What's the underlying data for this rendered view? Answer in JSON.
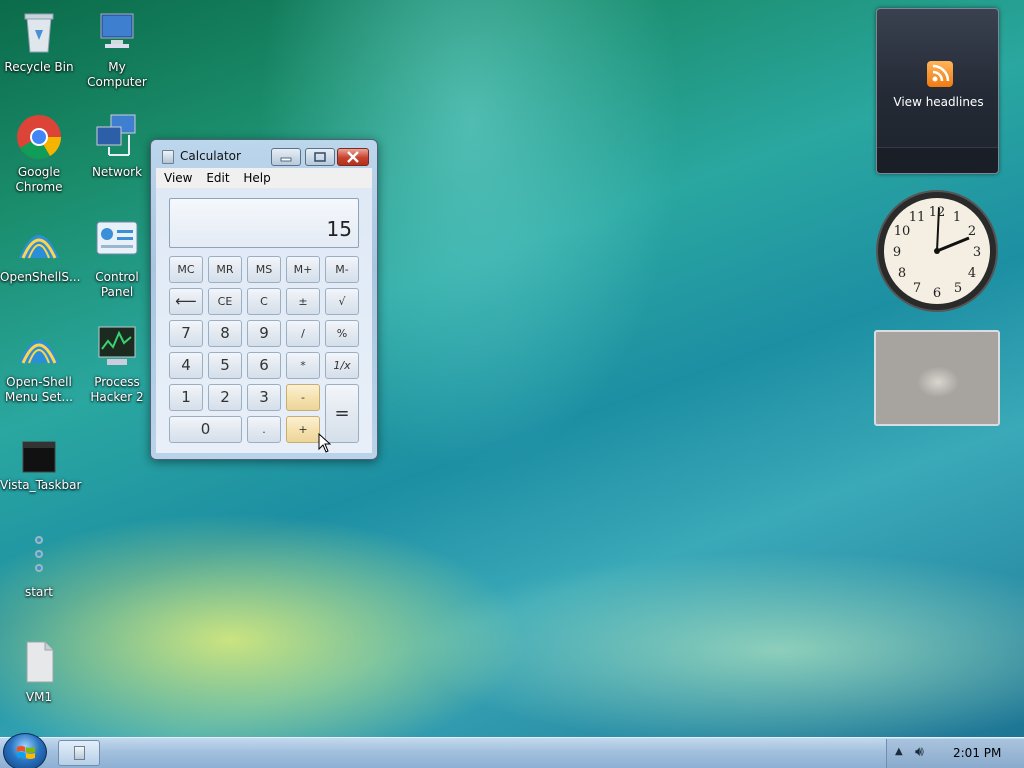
{
  "desktop": {
    "icons": [
      {
        "label": "Recycle Bin",
        "icon": "recycle-bin-icon"
      },
      {
        "label": "My Computer",
        "icon": "computer-icon"
      },
      {
        "label": "Google Chrome",
        "icon": "chrome-icon"
      },
      {
        "label": "Network",
        "icon": "network-icon"
      },
      {
        "label": "OpenShellS...",
        "icon": "openshell-icon"
      },
      {
        "label": "Control Panel",
        "icon": "control-panel-icon"
      },
      {
        "label": "Open-Shell Menu Set...",
        "icon": "openshell-icon"
      },
      {
        "label": "Process Hacker 2",
        "icon": "process-hacker-icon"
      },
      {
        "label": "Vista_Taskbar",
        "icon": "black-file-icon"
      },
      {
        "label": "start",
        "icon": "start-bat-icon"
      },
      {
        "label": "VM1",
        "icon": "file-icon"
      }
    ]
  },
  "calculator": {
    "title": "Calculator",
    "menu": [
      "View",
      "Edit",
      "Help"
    ],
    "display": "15",
    "keys": {
      "mc": "MC",
      "mr": "MR",
      "ms": "MS",
      "mplus": "M+",
      "mminus": "M-",
      "back": "⟵",
      "ce": "CE",
      "c": "C",
      "plusminus": "±",
      "sqrt": "√",
      "k7": "7",
      "k8": "8",
      "k9": "9",
      "div": "/",
      "pct": "%",
      "k4": "4",
      "k5": "5",
      "k6": "6",
      "mul": "*",
      "recip": "1/x",
      "k1": "1",
      "k2": "2",
      "k3": "3",
      "sub": "-",
      "eq": "=",
      "k0": "0",
      "dot": ".",
      "add": "+"
    }
  },
  "gadgets": {
    "feed_text": "View headlines",
    "clock_time": "2:01"
  },
  "taskbar": {
    "time": "2:01 PM"
  },
  "colors": {
    "accent": "#2a74c2",
    "close_button": "#c8412c",
    "op_highlight": "#f5e2b0"
  }
}
